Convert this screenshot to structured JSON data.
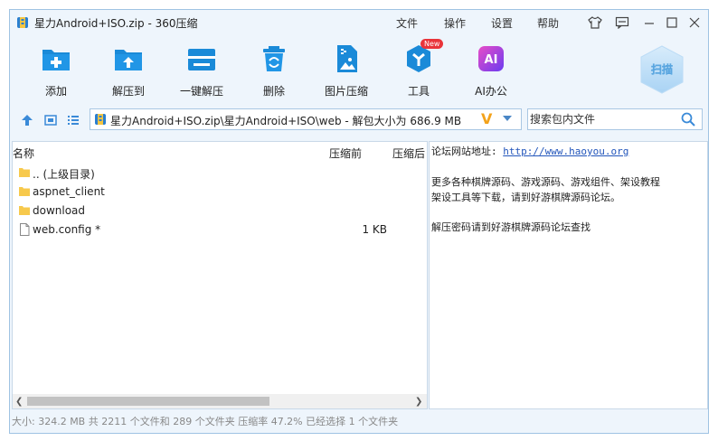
{
  "window": {
    "title": "星力Android+ISO.zip - 360压缩",
    "menu": [
      "文件",
      "操作",
      "设置",
      "帮助"
    ]
  },
  "toolbar": {
    "items": [
      {
        "label": "添加",
        "icon": "add-icon"
      },
      {
        "label": "解压到",
        "icon": "extract-to-icon"
      },
      {
        "label": "一键解压",
        "icon": "one-click-extract-icon"
      },
      {
        "label": "删除",
        "icon": "delete-icon"
      },
      {
        "label": "图片压缩",
        "icon": "image-compress-icon"
      },
      {
        "label": "工具",
        "icon": "tools-icon",
        "badge": "New"
      },
      {
        "label": "AI办公",
        "icon": "ai-office-icon",
        "icon_text": "AI"
      }
    ],
    "scan_label": "扫描"
  },
  "address": {
    "path": "星力Android+ISO.zip\\星力Android+ISO\\web - 解包大小为 686.9 MB",
    "v_mark": "V"
  },
  "search": {
    "placeholder": "搜索包内文件"
  },
  "file_list": {
    "columns": [
      "名称",
      "压缩前",
      "压缩后"
    ],
    "rows": [
      {
        "name": ".. (上级目录)",
        "type": "folder",
        "size": ""
      },
      {
        "name": "aspnet_client",
        "type": "folder",
        "size": ""
      },
      {
        "name": "download",
        "type": "folder",
        "size": ""
      },
      {
        "name": "web.config *",
        "type": "file",
        "size": "1 KB"
      }
    ]
  },
  "comment": {
    "line1_prefix": "论坛网站地址:",
    "line1_link": "http://www.haoyou.org",
    "line2": "更多各种棋牌源码、游戏源码、游戏组件、架设教程",
    "line3": "架设工具等下载，请到好游棋牌源码论坛。",
    "line4": "解压密码请到好游棋牌源码论坛查找"
  },
  "status": {
    "text": "大小: 324.2 MB 共 2211 个文件和 289 个文件夹 压缩率 47.2% 已经选择 1 个文件夹"
  },
  "colors": {
    "accent": "#1a8ad8",
    "folder": "#f7c94c",
    "window_bg": "#eef5fc",
    "badge": "#e9343a"
  }
}
